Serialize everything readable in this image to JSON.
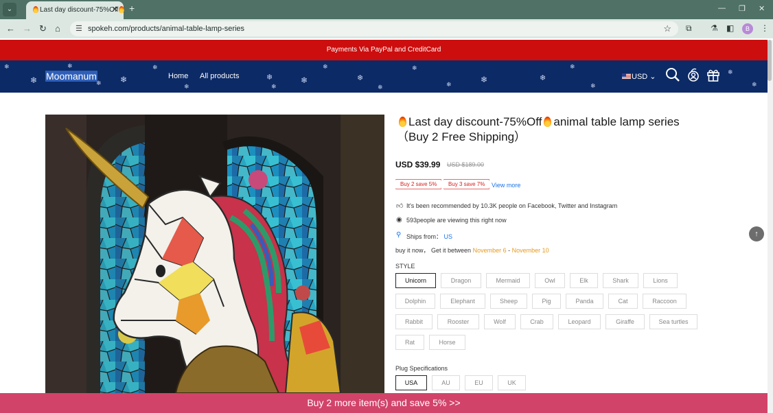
{
  "browser": {
    "tab_title": "Last day discount-75%Off",
    "url": "spokeh.com/products/animal-table-lamp-series",
    "profile_initial": "B"
  },
  "promo_bar": "Payments Via PayPal and CreditCard",
  "header": {
    "logo": "Moomanum",
    "nav": [
      "Home",
      "All products"
    ],
    "currency": "USD"
  },
  "product": {
    "title_part1": "Last day discount-75%Off",
    "title_part2": "animal table lamp series",
    "title_line2": "（Buy 2 Free Shipping）",
    "price": "USD $39.99",
    "old_price": "USD $189.00",
    "tags": [
      "Buy 2 save 5%",
      "Buy 3 save 7%"
    ],
    "view_more": "View more",
    "recommended": "It's been recommended by 10.3K people on Facebook, Twitter and Instagram",
    "viewing": "593people are viewing this right now",
    "ships_from_label": "Ships from：",
    "ships_from": "US",
    "buy_now": "buy it now，  Get it between",
    "date_from": "November 6",
    "date_sep": " - ",
    "date_to": "November 10",
    "style_label": "STYLE",
    "styles": [
      "Unicorn",
      "Dragon",
      "Mermaid",
      "Owl",
      "Elk",
      "Shark",
      "Lions",
      "Dolphin",
      "Elephant",
      "Sheep",
      "Pig",
      "Panda",
      "Cat",
      "Raccoon",
      "Rabbit",
      "Rooster",
      "Wolf",
      "Crab",
      "Leopard",
      "Giraffe",
      "Sea turtles",
      "Rat",
      "Horse"
    ],
    "selected_style": "Unicorn",
    "plug_label": "Plug Specifications",
    "plugs": [
      "USA",
      "AU",
      "EU",
      "UK"
    ],
    "selected_plug": "USA"
  },
  "bottom_bar": "Buy 2 more item(s) and save 5%  >>",
  "colors": {
    "promo_red": "#cc0e0e",
    "header_navy": "#0c2a66",
    "bottom_pink": "#d2436a",
    "link_blue": "#1a73e8",
    "date_orange": "#e59a1e"
  }
}
